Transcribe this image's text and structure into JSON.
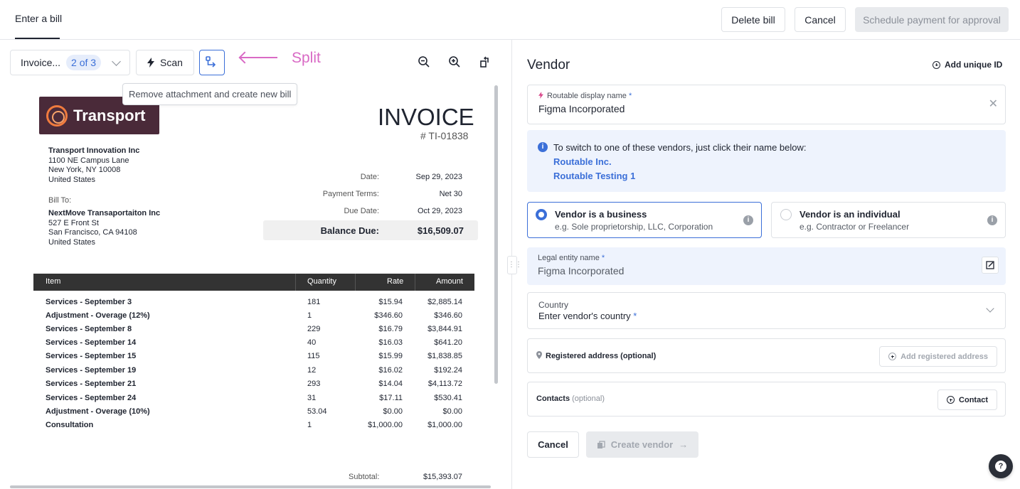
{
  "header": {
    "tab": "Enter a bill",
    "delete_label": "Delete bill",
    "cancel_label": "Cancel",
    "schedule_label": "Schedule payment for approval"
  },
  "toolbar": {
    "invoice_select": "Invoice...",
    "page_pill": "2 of 3",
    "scan_label": "Scan",
    "split_annotation": "Split",
    "tooltip": "Remove attachment and create new bill",
    "colors": {
      "accent": "#3b6fd8",
      "annotation": "#d96ac5"
    }
  },
  "invoice": {
    "logo_text": "Transport",
    "title": "INVOICE",
    "number": "# TI-01838",
    "from": [
      "Transport Innovation Inc",
      "1100 NE Campus Lane",
      "New York, NY 10008",
      "United States"
    ],
    "bill_to_label": "Bill To:",
    "to": [
      "NextMove Transaportaiton Inc",
      "527 E Front St",
      "San Francisco, CA 94108",
      "United States"
    ],
    "meta": [
      {
        "label": "Date:",
        "value": "Sep 29, 2023"
      },
      {
        "label": "Payment Terms:",
        "value": "Net 30"
      },
      {
        "label": "Due Date:",
        "value": "Oct 29, 2023"
      }
    ],
    "balance_label": "Balance Due:",
    "balance_value": "$16,509.07",
    "columns": [
      "Item",
      "Quantity",
      "Rate",
      "Amount"
    ],
    "rows": [
      {
        "item": "Services - September 3",
        "qty": "181",
        "rate": "$15.94",
        "amount": "$2,885.14"
      },
      {
        "item": "Adjustment - Overage (12%)",
        "qty": "1",
        "rate": "$346.60",
        "amount": "$346.60"
      },
      {
        "item": "Services - September 8",
        "qty": "229",
        "rate": "$16.79",
        "amount": "$3,844.91"
      },
      {
        "item": "Services - September 14",
        "qty": "40",
        "rate": "$16.03",
        "amount": "$641.20"
      },
      {
        "item": "Services - September 15",
        "qty": "115",
        "rate": "$15.99",
        "amount": "$1,838.85"
      },
      {
        "item": "Services - September 19",
        "qty": "12",
        "rate": "$16.02",
        "amount": "$192.24"
      },
      {
        "item": "Services - September 21",
        "qty": "293",
        "rate": "$14.04",
        "amount": "$4,113.72"
      },
      {
        "item": "Services - September 24",
        "qty": "31",
        "rate": "$17.11",
        "amount": "$530.41"
      },
      {
        "item": "Adjustment - Overage (10%)",
        "qty": "53.04",
        "rate": "$0.00",
        "amount": "$0.00"
      },
      {
        "item": "Consultation",
        "qty": "1",
        "rate": "$1,000.00",
        "amount": "$1,000.00"
      }
    ],
    "subtotal_label": "Subtotal:",
    "subtotal_value": "$15,393.07"
  },
  "vendor": {
    "heading": "Vendor",
    "add_unique_id": "Add unique ID",
    "display_name_label": "Routable display name",
    "display_name_value": "Figma Incorporated",
    "info_text": "To switch to one of these vendors, just click their name below:",
    "info_links": [
      "Routable Inc.",
      "Routable Testing 1"
    ],
    "business_title": "Vendor is a business",
    "business_sub": "e.g. Sole proprietorship, LLC, Corporation",
    "individual_title": "Vendor is an individual",
    "individual_sub": "e.g. Contractor or Freelancer",
    "legal_label": "Legal entity name",
    "legal_value": "Figma Incorporated",
    "country_label": "Country",
    "country_placeholder": "Enter vendor's country",
    "address_label": "Registered address (optional)",
    "add_address": "Add registered address",
    "contacts_label": "Contacts",
    "contacts_optional": "(optional)",
    "contact_button": "Contact",
    "cancel_label": "Cancel",
    "create_label": "Create vendor"
  }
}
